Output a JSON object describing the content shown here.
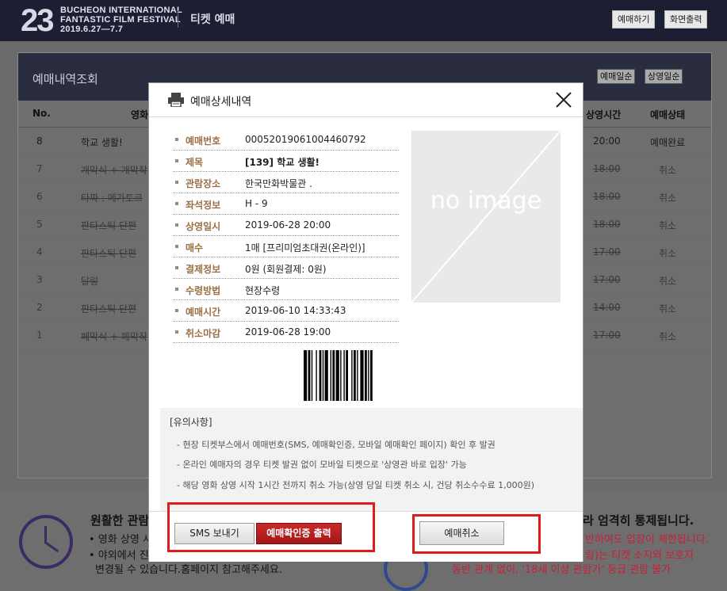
{
  "header": {
    "logo_number": "23",
    "logo_lines": [
      "BUCHEON INTERNATIONAL",
      "FANTASTIC FILM FESTIVAL",
      "2019.6.27—7.7"
    ],
    "section_title": "티켓 예매",
    "btn_reserve": "예매하기",
    "btn_print": "화면출력"
  },
  "background_page": {
    "title": "예매내역조회",
    "sort_booking": "예매일순",
    "sort_screening": "상영일순",
    "columns": {
      "no": "No.",
      "movie": "영화",
      "time": "상영시간",
      "status": "예매상태"
    },
    "rows": [
      {
        "no": "8",
        "movie": "학교 생활!",
        "time": "20:00",
        "status": "예매완료"
      },
      {
        "no": "7",
        "movie": "개막식 + 개막작",
        "time": "18:00",
        "status": "취소"
      },
      {
        "no": "6",
        "movie": "타짜 : 메가토크",
        "time": "18:00",
        "status": "취소"
      },
      {
        "no": "5",
        "movie": "판타스틱 단편",
        "time": "18:00",
        "status": "취소"
      },
      {
        "no": "4",
        "movie": "판타스틱 단편",
        "time": "17:00",
        "status": "취소"
      },
      {
        "no": "3",
        "movie": "달링",
        "time": "17:00",
        "status": "취소"
      },
      {
        "no": "2",
        "movie": "판타스틱 단편",
        "time": "14:00",
        "status": "취소"
      },
      {
        "no": "1",
        "movie": "폐막식 + 폐막작",
        "time": "17:00",
        "status": "취소"
      }
    ]
  },
  "notice": {
    "left_title": "원활한 관람",
    "left_lines": [
      "• 영화 상영 시",
      "• 야외에서 진행되는 상영 장소",
      "변경될 수 있습니다.홈페이지 참고해주세요."
    ],
    "right_title": "라 엄격히 통제됩니다.",
    "right_lines": [
      "반하여도 입장이 제한됩니다.",
      "람)는 티켓 소지와 보호자",
      "동반 관계 없이, '18세 이상 관람가' 등급 관람 불가"
    ]
  },
  "modal": {
    "title": "예매상세내역",
    "details": [
      {
        "label": "예매번호",
        "value": "00052019061004460792",
        "bold": false
      },
      {
        "label": "제목",
        "value": "[139] 학교 생활!",
        "bold": true
      },
      {
        "label": "관람장소",
        "value": "한국만화박물관 .",
        "bold": false
      },
      {
        "label": "좌석정보",
        "value": "H - 9",
        "bold": false
      },
      {
        "label": "상영일시",
        "value": "2019-06-28 20:00",
        "bold": false
      },
      {
        "label": "매수",
        "value": "1매 [프리미엄초대권(온라인)]",
        "bold": false
      },
      {
        "label": "결제정보",
        "value": "0원 (회원결제: 0원)",
        "bold": false
      },
      {
        "label": "수령방법",
        "value": "현장수령",
        "bold": false
      },
      {
        "label": "예매시간",
        "value": "2019-06-10 14:33:43",
        "bold": false
      },
      {
        "label": "취소마감",
        "value": "2019-06-28 19:00",
        "bold": false
      }
    ],
    "poster_placeholder": "no image",
    "notes_title": "[유의사항]",
    "notes": [
      "- 현장 티켓부스에서 예매번호(SMS, 예매확인증, 모바일 예매확인 페이지) 확인 후 발권",
      "- 온라인 예매자의 경우 티켓 발권 없이 모바일 티켓으로 '상영관 바로 입장' 가능",
      "- 해당 영화 상영 시작 1시간 전까지 취소 가능(상영 당일 티켓 취소 시, 건당 취소수수료 1,000원)"
    ],
    "btn_sms": "SMS 보내기",
    "btn_print_confirm": "예매확인증 출력",
    "btn_cancel": "예매취소"
  },
  "colors": {
    "header_bg": "#1c1f33",
    "label_brown": "#9b6f45",
    "primary_red": "#b51f1f",
    "highlight_red": "#e11a1a"
  }
}
